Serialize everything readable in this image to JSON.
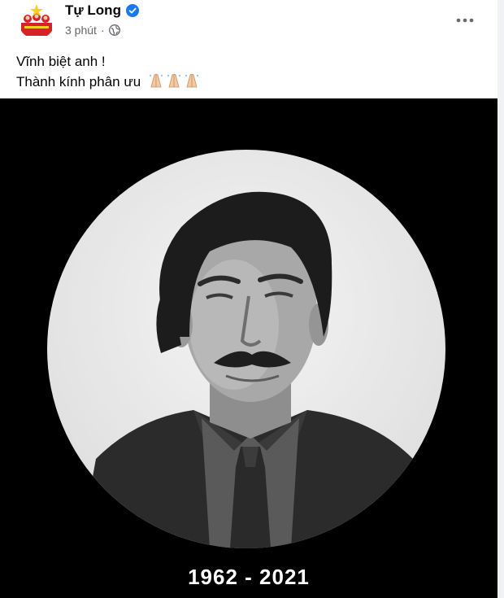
{
  "post": {
    "author": "Tự Long",
    "timestamp": "3 phút",
    "separator": "·",
    "privacy_icon": "globe-icon",
    "verified_icon": "verified-badge-icon",
    "more_icon": "more-options-icon",
    "caption_lines": [
      "Vĩnh biệt anh !",
      "Thành kính phân ưu"
    ],
    "caption_emoji": [
      "folded-hands-icon",
      "folded-hands-icon",
      "folded-hands-icon"
    ],
    "image": {
      "background": "#000000",
      "years": "1962 - 2021"
    }
  },
  "colors": {
    "name": "#050505",
    "meta": "#65676b",
    "verified": "#1877f2",
    "avatar_red": "#d6212a",
    "avatar_yellow": "#f8d01b"
  }
}
